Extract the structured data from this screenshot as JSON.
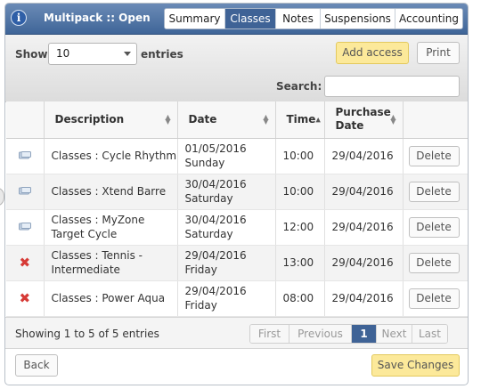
{
  "header": {
    "title": "Multipack :: Open",
    "tabs": [
      {
        "label": "Summary",
        "active": false
      },
      {
        "label": "Classes",
        "active": true
      },
      {
        "label": "Notes",
        "active": false
      },
      {
        "label": "Suspensions",
        "active": false
      },
      {
        "label": "Accounting",
        "active": false
      }
    ]
  },
  "toolbar": {
    "show_label": "Show",
    "page_length": "10",
    "entries_label": "entries",
    "add_access_label": "Add access",
    "print_label": "Print",
    "search_label": "Search:",
    "search_value": ""
  },
  "table": {
    "columns": [
      "",
      "Description",
      "Date",
      "Time",
      "Purchase Date",
      ""
    ],
    "sorted_column": "Time",
    "rows": [
      {
        "status_icon": "card-icon",
        "description": "Classes : Cycle Rhythm",
        "date": "01/05/2016",
        "day": "Sunday",
        "time": "10:00",
        "purchase_date": "29/04/2016",
        "action": "Delete"
      },
      {
        "status_icon": "card-icon",
        "description": "Classes : Xtend Barre",
        "date": "30/04/2016",
        "day": "Saturday",
        "time": "10:00",
        "purchase_date": "29/04/2016",
        "action": "Delete"
      },
      {
        "status_icon": "card-icon",
        "description": "Classes : MyZone Target Cycle",
        "date": "30/04/2016",
        "day": "Saturday",
        "time": "12:00",
        "purchase_date": "29/04/2016",
        "action": "Delete"
      },
      {
        "status_icon": "cross-icon",
        "description": "Classes : Tennis - Intermediate",
        "date": "29/04/2016",
        "day": "Friday",
        "time": "13:00",
        "purchase_date": "29/04/2016",
        "action": "Delete"
      },
      {
        "status_icon": "cross-icon",
        "description": "Classes : Power Aqua",
        "date": "29/04/2016",
        "day": "Friday",
        "time": "08:00",
        "purchase_date": "29/04/2016",
        "action": "Delete"
      }
    ]
  },
  "footer": {
    "info": "Showing 1 to 5 of 5 entries",
    "pager": {
      "first": "First",
      "previous": "Previous",
      "current": "1",
      "next": "Next",
      "last": "Last"
    }
  },
  "actions": {
    "back_label": "Back",
    "save_label": "Save Changes"
  },
  "colors": {
    "header_blue": "#3f6396",
    "accent_yellow": "#fce99a",
    "cross_red": "#d63a36"
  }
}
